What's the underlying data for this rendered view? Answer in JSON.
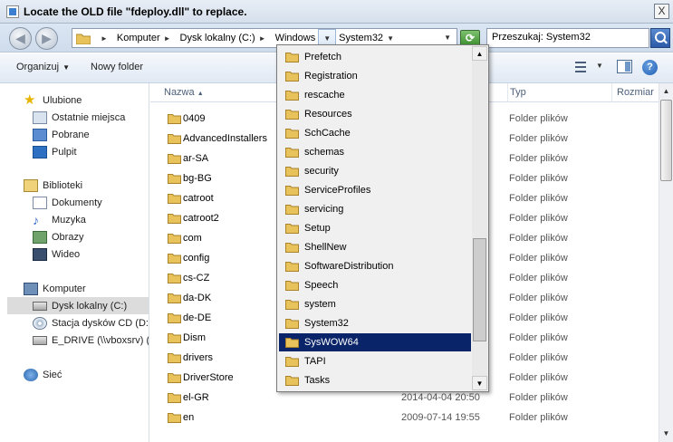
{
  "window": {
    "title": "Locate the OLD file \"fdeploy.dll\" to replace.",
    "close_label": "X"
  },
  "address": {
    "crumbs": [
      "Komputer",
      "Dysk lokalny (C:)",
      "Windows",
      "System32"
    ],
    "search_placeholder": "Przeszukaj: System32"
  },
  "toolbar": {
    "organize_label": "Organizuj",
    "new_folder_label": "Nowy folder",
    "help_label": "?"
  },
  "nav": {
    "favorites_label": "Ulubione",
    "favorites": [
      "Ostatnie miejsca",
      "Pobrane",
      "Pulpit"
    ],
    "libraries_label": "Biblioteki",
    "libraries": [
      "Dokumenty",
      "Muzyka",
      "Obrazy",
      "Wideo"
    ],
    "computer_label": "Komputer",
    "drives": [
      "Dysk lokalny (C:)",
      "Stacja dysków CD (D:)",
      "E_DRIVE (\\\\vboxsrv) ("
    ],
    "network_label": "Sieć"
  },
  "columns": {
    "name": "Nazwa",
    "type": "Typ",
    "size": "Rozmiar"
  },
  "files": [
    {
      "name": "0409",
      "date": "",
      "type": "Folder plików"
    },
    {
      "name": "AdvancedInstallers",
      "date": "",
      "type": "Folder plików"
    },
    {
      "name": "ar-SA",
      "date": "",
      "type": "Folder plików"
    },
    {
      "name": "bg-BG",
      "date": "",
      "type": "Folder plików"
    },
    {
      "name": "catroot",
      "date": "",
      "type": "Folder plików"
    },
    {
      "name": "catroot2",
      "date": "",
      "type": "Folder plików"
    },
    {
      "name": "com",
      "date": "",
      "type": "Folder plików"
    },
    {
      "name": "config",
      "date": "",
      "type": "Folder plików"
    },
    {
      "name": "cs-CZ",
      "date": "",
      "type": "Folder plików"
    },
    {
      "name": "da-DK",
      "date": "",
      "type": "Folder plików"
    },
    {
      "name": "de-DE",
      "date": "",
      "type": "Folder plików"
    },
    {
      "name": "Dism",
      "date": "",
      "type": "Folder plików"
    },
    {
      "name": "drivers",
      "date": "",
      "type": "Folder plików"
    },
    {
      "name": "DriverStore",
      "date": "",
      "type": "Folder plików"
    },
    {
      "name": "el-GR",
      "date": "2014-04-04 20:50",
      "type": "Folder plików"
    },
    {
      "name": "en",
      "date": "2009-07-14 19:55",
      "type": "Folder plików"
    }
  ],
  "dropdown": {
    "items": [
      "Prefetch",
      "Registration",
      "rescache",
      "Resources",
      "SchCache",
      "schemas",
      "security",
      "ServiceProfiles",
      "servicing",
      "Setup",
      "ShellNew",
      "SoftwareDistribution",
      "Speech",
      "system",
      "System32",
      "SysWOW64",
      "TAPI",
      "Tasks"
    ],
    "selected": "SysWOW64"
  },
  "colors": {
    "accent": "#0a246a",
    "folder": "#e8c25a"
  }
}
